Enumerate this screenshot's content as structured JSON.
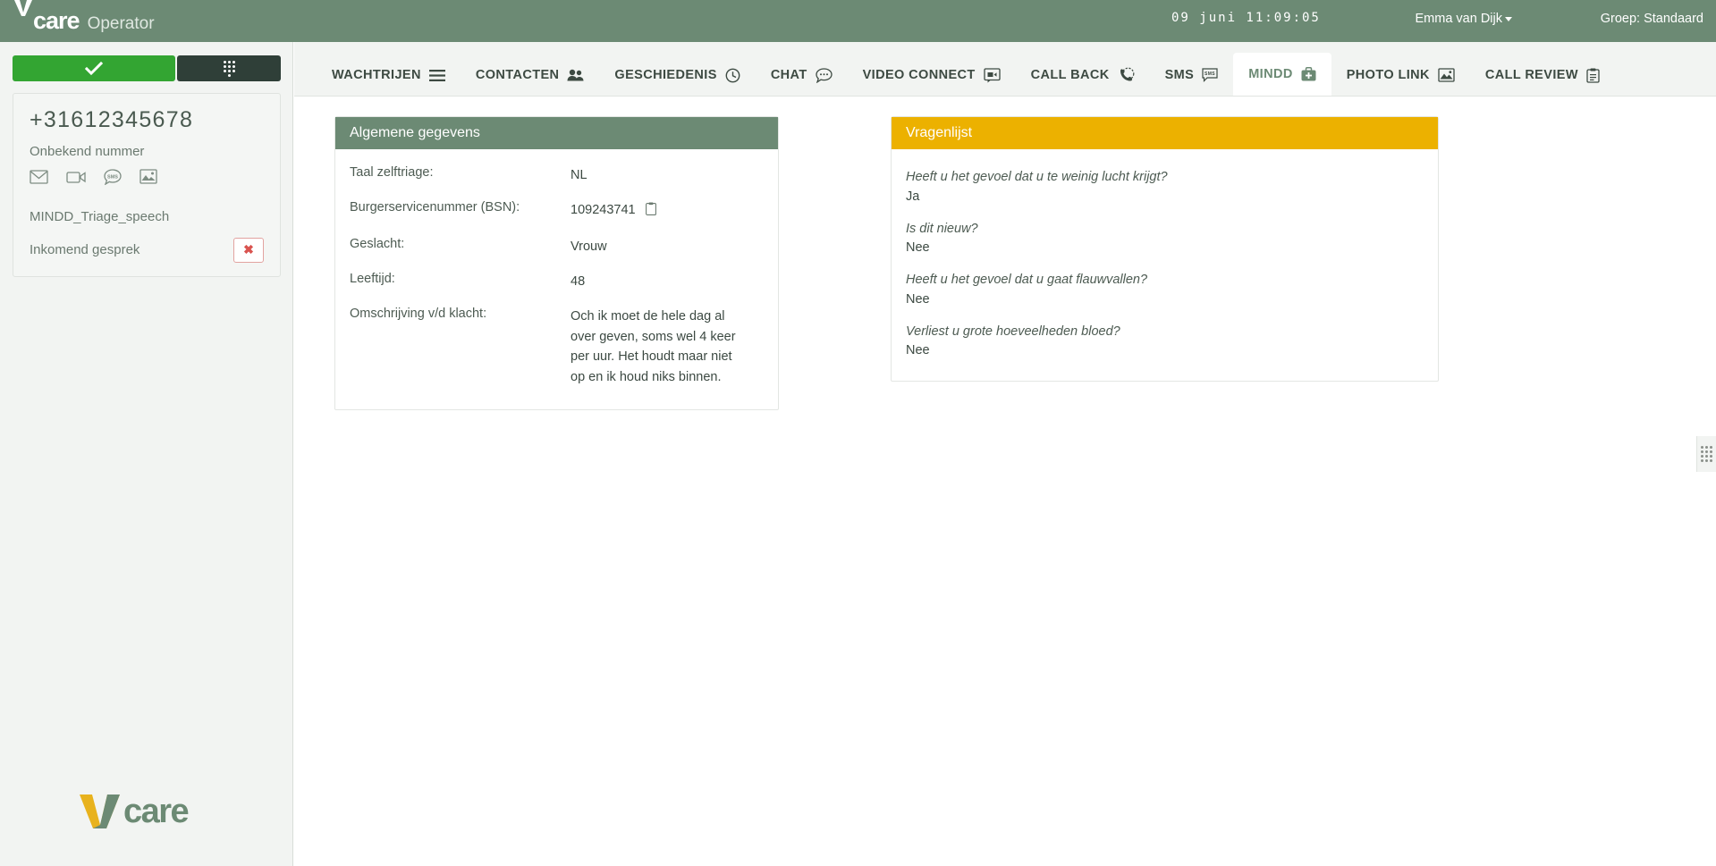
{
  "header": {
    "brand": "care",
    "brand_sub": "Operator",
    "clock": "09 juni 11:09:05",
    "user": "Emma van Dijk",
    "group": "Groep: Standaard"
  },
  "sidebar": {
    "accept_icon": "checkmark-icon",
    "keypad_icon": "dialpad-icon",
    "phone_number": "+31612345678",
    "caller_name": "Onbekend nummer",
    "channels": [
      {
        "name": "email-icon",
        "label": "E-mail"
      },
      {
        "name": "video-icon",
        "label": "Video"
      },
      {
        "name": "sms-icon",
        "label": "SMS"
      },
      {
        "name": "photo-icon",
        "label": "Foto"
      }
    ],
    "triage_name": "MINDD_Triage_speech",
    "call_state": "Inkomend gesprek",
    "hangup_label": "✖",
    "logo_word": "care"
  },
  "tabs": [
    {
      "label": "WACHTRIJEN",
      "icon": "hamburger-icon",
      "active": false
    },
    {
      "label": "CONTACTEN",
      "icon": "people-icon",
      "active": false
    },
    {
      "label": "GESCHIEDENIS",
      "icon": "clock-history-icon",
      "active": false
    },
    {
      "label": "CHAT",
      "icon": "chat-bubble-icon",
      "active": false
    },
    {
      "label": "VIDEO CONNECT",
      "icon": "video-camera-icon",
      "active": false
    },
    {
      "label": "CALL BACK",
      "icon": "phone-clock-icon",
      "active": false
    },
    {
      "label": "SMS",
      "icon": "sms-bubble-icon",
      "active": false
    },
    {
      "label": "MINDD",
      "icon": "medical-bag-icon",
      "active": true
    },
    {
      "label": "PHOTO LINK",
      "icon": "photo-icon",
      "active": false
    },
    {
      "label": "CALL REVIEW",
      "icon": "clipboard-icon",
      "active": false
    }
  ],
  "general_panel": {
    "title": "Algemene gegevens",
    "accent": "#6c8a74",
    "rows": [
      {
        "label": "Taal zelftriage:",
        "value": "NL",
        "copyable": false
      },
      {
        "label": "Burgerservicenummer (BSN):",
        "value": "109243741",
        "copyable": true
      },
      {
        "label": "Geslacht:",
        "value": "Vrouw",
        "copyable": false
      },
      {
        "label": "Leeftijd:",
        "value": "48",
        "copyable": false
      },
      {
        "label": "Omschrijving v/d klacht:",
        "value": "Och ik moet de hele dag al over geven, soms wel 4 keer per uur. Het houdt maar niet op en ik houd niks binnen.",
        "copyable": false
      }
    ]
  },
  "questionnaire_panel": {
    "title": "Vragenlijst",
    "accent": "#ecb100",
    "items": [
      {
        "question": "Heeft u het gevoel dat u te weinig lucht krijgt?",
        "answer": "Ja"
      },
      {
        "question": "Is dit nieuw?",
        "answer": "Nee"
      },
      {
        "question": "Heeft u het gevoel dat u gaat flauwvallen?",
        "answer": "Nee"
      },
      {
        "question": "Verliest u grote hoeveelheden bloed?",
        "answer": "Nee"
      }
    ]
  },
  "right_grip": {
    "icon": "grip-dots-icon"
  }
}
